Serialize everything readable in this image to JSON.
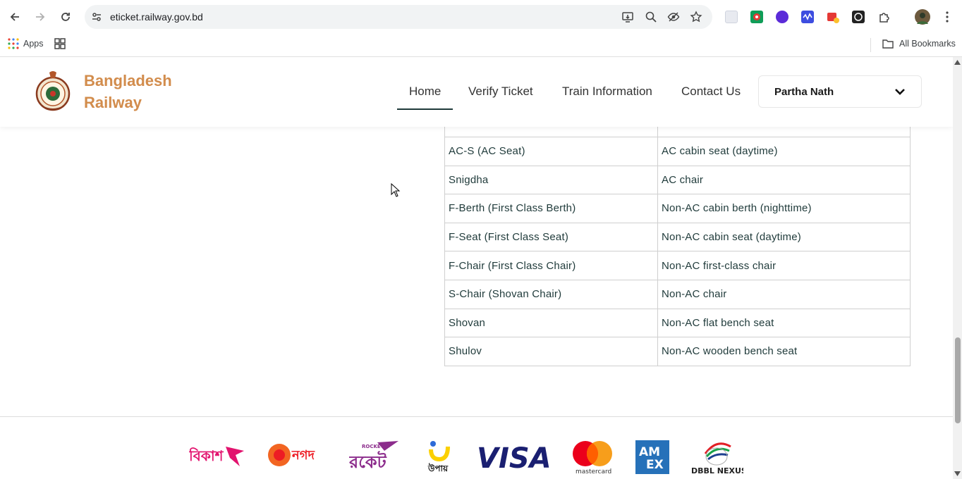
{
  "browser": {
    "url": "eticket.railway.gov.bd",
    "bookmarks": {
      "apps_label": "Apps",
      "all_bookmarks_label": "All Bookmarks"
    }
  },
  "site": {
    "brand_line1": "Bangladesh",
    "brand_line2": "Railway",
    "nav": {
      "home": "Home",
      "verify": "Verify Ticket",
      "train_info": "Train Information",
      "contact": "Contact Us"
    },
    "user_name": "Partha Nath",
    "colors": {
      "brand": "#d28c4c",
      "nav_underline": "#1f3a3a",
      "table_text": "#1f3a3a"
    }
  },
  "table": {
    "rows": [
      {
        "cls": "AC-S (AC Seat)",
        "desc": "AC cabin seat (daytime)"
      },
      {
        "cls": "Snigdha",
        "desc": "AC chair"
      },
      {
        "cls": "F-Berth (First Class Berth)",
        "desc": "Non-AC cabin berth (nighttime)"
      },
      {
        "cls": "F-Seat (First Class Seat)",
        "desc": "Non-AC cabin seat (daytime)"
      },
      {
        "cls": "F-Chair (First Class Chair)",
        "desc": "Non-AC first-class chair"
      },
      {
        "cls": "S-Chair (Shovan Chair)",
        "desc": "Non-AC chair"
      },
      {
        "cls": "Shovan",
        "desc": "Non-AC flat bench seat"
      },
      {
        "cls": "Shulov",
        "desc": "Non-AC wooden bench seat"
      }
    ]
  },
  "footer": {
    "payment_logos": [
      "bKash",
      "Nagad",
      "Rocket",
      "Upay",
      "VISA",
      "mastercard",
      "AMEX",
      "DBBL NEXUS"
    ],
    "visa_text": "VISA",
    "mastercard_text": "mastercard",
    "amex_text": "AM EX",
    "nexus_text": "DBBL NEXUS"
  }
}
